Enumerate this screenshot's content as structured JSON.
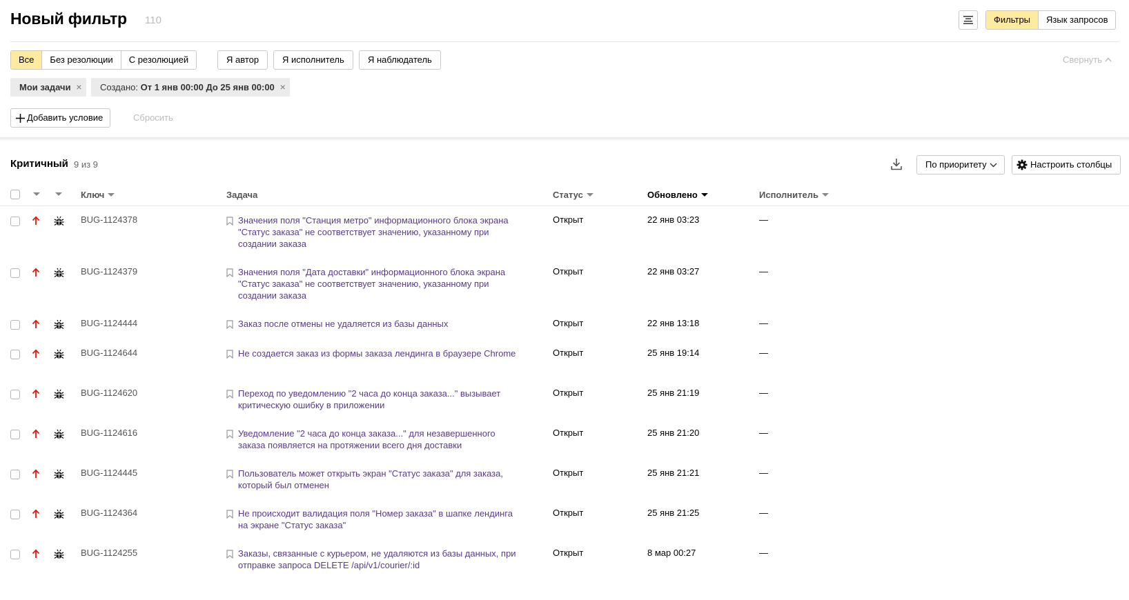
{
  "header": {
    "title": "Новый фильтр",
    "count": "110",
    "mode_tabs": [
      {
        "label": "Фильтры",
        "active": true
      },
      {
        "label": "Язык запросов",
        "active": false
      }
    ]
  },
  "resolution_tabs": [
    {
      "label": "Все",
      "active": true
    },
    {
      "label": "Без резолюции",
      "active": false
    },
    {
      "label": "С резолюцией",
      "active": false
    }
  ],
  "role_buttons": [
    "Я автор",
    "Я исполнитель",
    "Я наблюдатель"
  ],
  "collapse_label": "Свернуть",
  "chips": {
    "my_tasks": "Мои задачи",
    "created_label": "Создано:",
    "created_value": "От 1 янв 00:00 До 25 янв 00:00"
  },
  "add_condition_label": "Добавить условие",
  "reset_label": "Сбросить",
  "group": {
    "title": "Критичный",
    "count": "9 из 9"
  },
  "toolbar": {
    "sort_label": "По приоритету",
    "columns_label": "Настроить столбцы"
  },
  "columns": {
    "key": "Ключ",
    "task": "Задача",
    "status": "Статус",
    "updated": "Обновлено",
    "assignee": "Исполнитель"
  },
  "colors": {
    "active_tab": "#ffeba0",
    "link": "#5a3b8c",
    "priority": "#e8150e"
  },
  "rows": [
    {
      "key": "BUG-1124378",
      "summary": "Значения поля \"Станция метро\" информационного блока экрана \"Статус заказа\" не соответствует значению, указанному при создании заказа",
      "status": "Открыт",
      "updated": "22 янв 03:23",
      "assignee": "—"
    },
    {
      "key": "BUG-1124379",
      "summary": "Значения поля \"Дата доставки\" информационного блока экрана \"Статус заказа\" не соответствует значению, указанному при создании заказа",
      "status": "Открыт",
      "updated": "22 янв 03:27",
      "assignee": "—"
    },
    {
      "key": "BUG-1124444",
      "summary": "Заказ после отмены не удаляется из базы данных",
      "status": "Открыт",
      "updated": "22 янв 13:18",
      "assignee": "—"
    },
    {
      "key": "BUG-1124644",
      "summary": "Не создается заказ из формы заказа лендинга в браузере Chrome",
      "status": "Открыт",
      "updated": "25 янв 19:14",
      "assignee": "—"
    },
    {
      "key": "BUG-1124620",
      "summary": "Переход по уведомлению \"2 часа до конца заказа...\" вызывает критическую ошибку в приложении",
      "status": "Открыт",
      "updated": "25 янв 21:19",
      "assignee": "—"
    },
    {
      "key": "BUG-1124616",
      "summary": "Уведомление \"2 часа до конца заказа...\" для незавершенного заказа появляется на протяжении всего дня доставки",
      "status": "Открыт",
      "updated": "25 янв 21:20",
      "assignee": "—"
    },
    {
      "key": "BUG-1124445",
      "summary": "Пользователь может открыть экран \"Статус заказа\" для заказа, который был отменен",
      "status": "Открыт",
      "updated": "25 янв 21:21",
      "assignee": "—"
    },
    {
      "key": "BUG-1124364",
      "summary": "Не происходит валидация поля \"Номер заказа\" в шапке лендинга на экране \"Статус заказа\"",
      "status": "Открыт",
      "updated": "25 янв 21:25",
      "assignee": "—"
    },
    {
      "key": "BUG-1124255",
      "summary": "Заказы, связанные с курьером, не удаляются из базы данных, при отправке запроса DELETE /api/v1/courier/:id",
      "status": "Открыт",
      "updated": "8 мар 00:27",
      "assignee": "—"
    }
  ]
}
